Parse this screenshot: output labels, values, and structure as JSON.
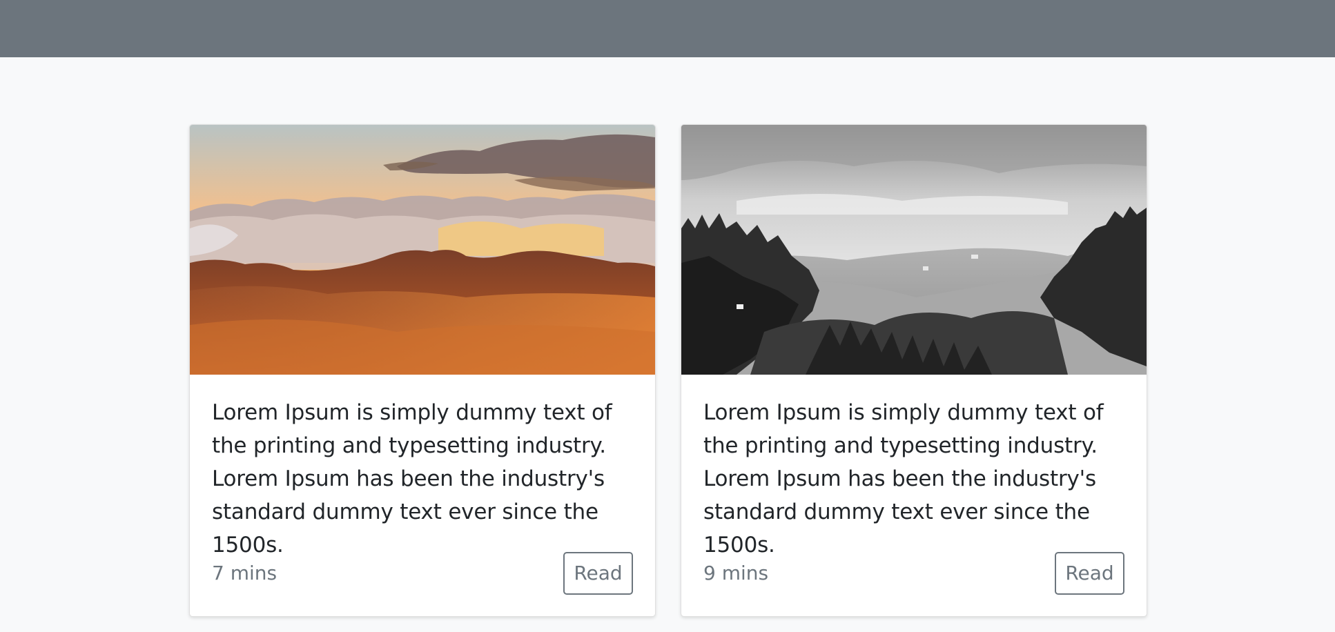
{
  "header": {
    "background": "#6c757d"
  },
  "cards": [
    {
      "image": "mountain-sunset-photo",
      "text": "Lorem Ipsum is simply dummy text of the printing and typesetting industry. Lorem Ipsum has been the industry's standard dummy text ever since the 1500s.",
      "read_time": "7 mins",
      "button_label": "Read"
    },
    {
      "image": "black-white-valley-photo",
      "text": "Lorem Ipsum is simply dummy text of the printing and typesetting industry. Lorem Ipsum has been the industry's standard dummy text ever since the 1500s.",
      "read_time": "9 mins",
      "button_label": "Read"
    }
  ],
  "colors": {
    "page_background": "#f8f9fa",
    "text": "#212529",
    "muted": "#6c757d"
  }
}
